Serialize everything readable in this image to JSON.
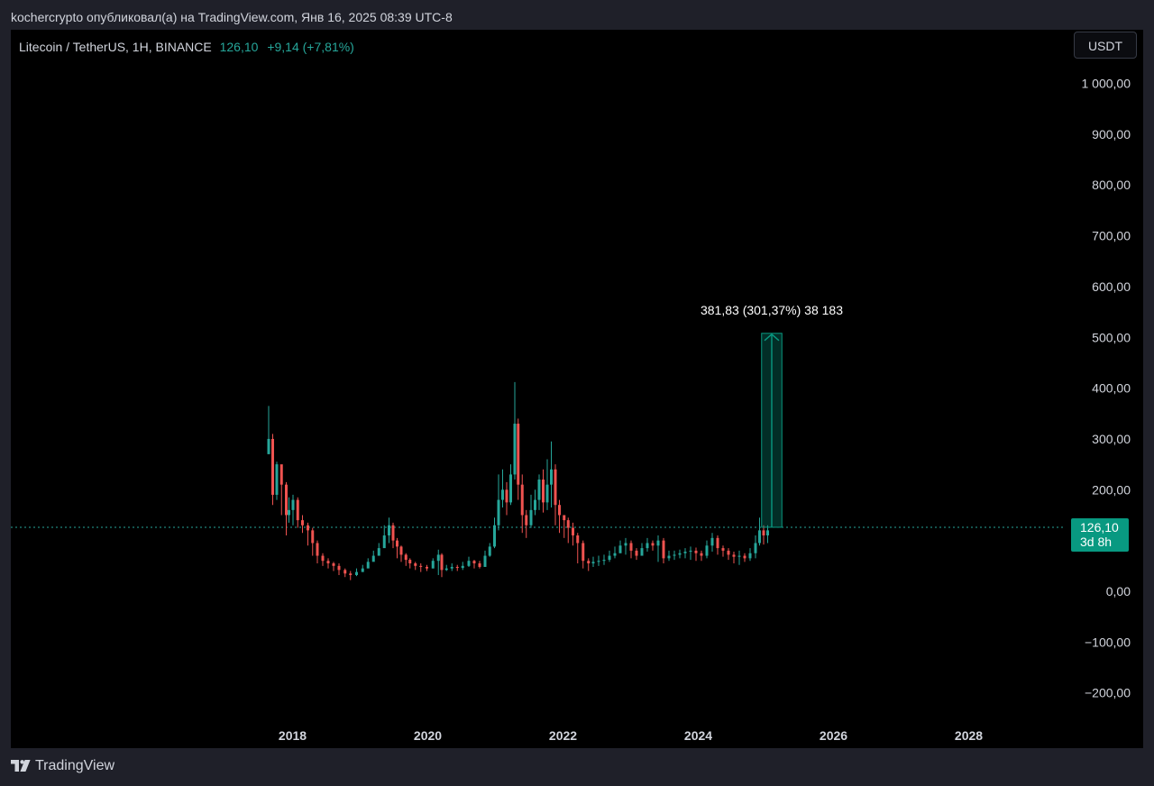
{
  "header": {
    "publish_text": "kochercrypto опубликовал(а) на TradingView.com, Янв 16, 2025 08:39 UTC-8"
  },
  "symbol": {
    "name": "Litecoin / TetherUS, 1H, BINANCE",
    "price": "126,10",
    "change": "+9,14 (+7,81%)"
  },
  "toolbar": {
    "currency_label": "USDT"
  },
  "price_marker": {
    "value": "126,10",
    "countdown": "3d 8h",
    "color": "#089981"
  },
  "measure": {
    "label": "381,83 (301,37%) 38 183",
    "color": "#089981"
  },
  "footer": {
    "brand": "TradingView"
  },
  "colors": {
    "up": "#26a69a",
    "down": "#ef5350",
    "background": "#000000",
    "text": "#d1d4dc",
    "current_price_line": "#26a69a"
  },
  "chart_data": {
    "type": "candlestick",
    "title": "Litecoin / TetherUS, 1H, BINANCE",
    "x_ticks": [
      "2018",
      "2020",
      "2022",
      "2024",
      "2026",
      "2028"
    ],
    "y_ticks": [
      "1 000,00",
      "900,00",
      "800,00",
      "700,00",
      "600,00",
      "500,00",
      "400,00",
      "300,00",
      "200,00",
      "0,00",
      "−100,00",
      "−200,00"
    ],
    "y_tick_values": [
      1000,
      900,
      800,
      700,
      600,
      500,
      400,
      300,
      200,
      0,
      -100,
      -200
    ],
    "ylim": [
      -240,
      1050
    ],
    "xlim": [
      2014.0,
      2029.8
    ],
    "grid": false,
    "current_price": 126.1,
    "series": [
      {
        "x": [
          2017.66,
          2017.72,
          2017.78,
          2017.85,
          2017.92,
          2017.96,
          2018.02,
          2018.09,
          2018.16,
          2018.24,
          2018.31,
          2018.38,
          2018.46,
          2018.54,
          2018.62,
          2018.7,
          2018.79,
          2018.87,
          2018.96,
          2019.05,
          2019.13,
          2019.21,
          2019.29,
          2019.37,
          2019.44,
          2019.5,
          2019.56,
          2019.62,
          2019.69,
          2019.75,
          2019.83,
          2019.91,
          2020.0,
          2020.09,
          2020.17,
          2020.22,
          2020.29,
          2020.37,
          2020.45,
          2020.53,
          2020.62,
          2020.7,
          2020.78,
          2020.86,
          2020.93,
          2021.0,
          2021.06,
          2021.12,
          2021.18,
          2021.24,
          2021.3,
          2021.35,
          2021.41,
          2021.47,
          2021.54,
          2021.6,
          2021.66,
          2021.72,
          2021.78,
          2021.84,
          2021.9,
          2021.96,
          2022.03,
          2022.09,
          2022.16,
          2022.23,
          2022.31,
          2022.39,
          2022.46,
          2022.54,
          2022.62,
          2022.7,
          2022.78,
          2022.86,
          2022.94,
          2023.02,
          2023.1,
          2023.18,
          2023.26,
          2023.34,
          2023.42,
          2023.5,
          2023.58,
          2023.66,
          2023.74,
          2023.82,
          2023.9,
          2023.98,
          2024.06,
          2024.14,
          2024.22,
          2024.3,
          2024.38,
          2024.46,
          2024.54,
          2024.62,
          2024.7,
          2024.78,
          2024.86,
          2024.92,
          2024.98,
          2025.04
        ],
        "close": [
          300,
          190,
          250,
          210,
          150,
          160,
          180,
          140,
          130,
          120,
          95,
          70,
          60,
          55,
          50,
          42,
          35,
          32,
          38,
          45,
          58,
          70,
          85,
          110,
          130,
          100,
          88,
          72,
          62,
          55,
          50,
          48,
          45,
          60,
          72,
          42,
          45,
          48,
          46,
          50,
          60,
          55,
          48,
          70,
          88,
          130,
          180,
          200,
          175,
          230,
          330,
          210,
          150,
          130,
          160,
          180,
          220,
          175,
          210,
          240,
          170,
          150,
          140,
          125,
          110,
          95,
          60,
          55,
          58,
          60,
          62,
          70,
          75,
          90,
          95,
          80,
          70,
          85,
          95,
          90,
          100,
          65,
          70,
          72,
          75,
          78,
          80,
          75,
          70,
          90,
          105,
          85,
          80,
          72,
          68,
          70,
          65,
          75,
          95,
          120,
          110,
          120
        ],
        "high": [
          365,
          310,
          255,
          245,
          215,
          185,
          190,
          185,
          150,
          135,
          125,
          100,
          75,
          65,
          58,
          55,
          45,
          40,
          45,
          52,
          65,
          80,
          95,
          130,
          145,
          135,
          105,
          90,
          75,
          65,
          58,
          55,
          52,
          65,
          82,
          75,
          52,
          55,
          52,
          58,
          68,
          62,
          60,
          80,
          95,
          145,
          230,
          240,
          215,
          250,
          412,
          340,
          230,
          160,
          190,
          200,
          230,
          240,
          260,
          295,
          250,
          180,
          150,
          145,
          135,
          115,
          100,
          65,
          68,
          70,
          72,
          80,
          88,
          100,
          105,
          100,
          85,
          95,
          105,
          100,
          110,
          105,
          80,
          80,
          82,
          85,
          88,
          86,
          80,
          100,
          115,
          110,
          90,
          85,
          78,
          80,
          75,
          85,
          110,
          145,
          130,
          130
        ],
        "low": [
          270,
          170,
          180,
          150,
          110,
          135,
          130,
          125,
          115,
          90,
          70,
          55,
          50,
          45,
          40,
          32,
          28,
          22,
          30,
          38,
          50,
          62,
          75,
          100,
          95,
          85,
          65,
          58,
          50,
          45,
          42,
          38,
          40,
          45,
          32,
          28,
          40,
          40,
          40,
          42,
          48,
          45,
          45,
          52,
          68,
          85,
          120,
          165,
          150,
          170,
          220,
          180,
          115,
          105,
          125,
          150,
          160,
          155,
          160,
          165,
          130,
          115,
          105,
          95,
          90,
          55,
          45,
          40,
          48,
          50,
          52,
          58,
          65,
          75,
          72,
          65,
          62,
          70,
          78,
          80,
          58,
          55,
          60,
          62,
          65,
          65,
          62,
          60,
          60,
          65,
          78,
          72,
          68,
          62,
          55,
          52,
          58,
          60,
          65,
          90,
          92,
          95
        ]
      }
    ]
  }
}
